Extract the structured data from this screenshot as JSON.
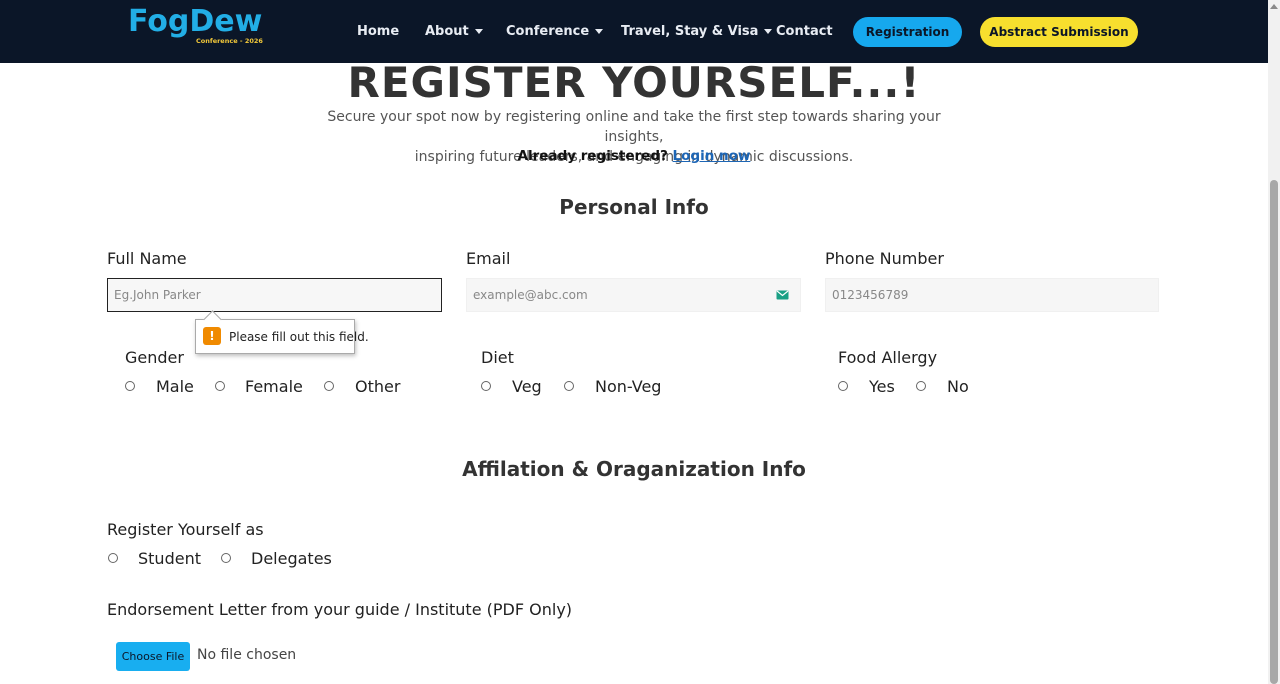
{
  "header": {
    "logo_text": "FogDew",
    "logo_sub": "Conference - 2026",
    "nav": [
      {
        "label": "Home"
      },
      {
        "label": "About"
      },
      {
        "label": "Conference"
      },
      {
        "label": "Travel, Stay & Visa"
      },
      {
        "label": "Contact"
      }
    ],
    "registration_label": "Registration",
    "abstract_label": "Abstract Submission"
  },
  "hero": {
    "title": "REGISTER YOURSELF...!",
    "subtitle_line1": "Secure your spot now by registering online and take the first step towards sharing your insights,",
    "subtitle_line2": "inspiring future leaders, and engaging in dynamic discussions.",
    "already_text": "Already registered?",
    "login_label": "Login now"
  },
  "personal": {
    "title": "Personal Info",
    "full_name_label": "Full Name",
    "full_name_placeholder": "Eg.John Parker",
    "email_label": "Email",
    "email_placeholder": "example@abc.com",
    "phone_label": "Phone Number",
    "phone_placeholder": "0123456789",
    "validation_message": "Please fill out this field.",
    "gender_label": "Gender",
    "gender_options": [
      "Male",
      "Female",
      "Other"
    ],
    "diet_label": "Diet",
    "diet_options": [
      "Veg",
      "Non-Veg"
    ],
    "allergy_label": "Food Allergy",
    "allergy_options": [
      "Yes",
      "No"
    ]
  },
  "affiliation": {
    "title": "Affilation & Oraganization Info",
    "register_as_label": "Register Yourself as",
    "register_as_options": [
      "Student",
      "Delegates"
    ],
    "endorsement_label": "Endorsement Letter from your guide / Institute (PDF Only)",
    "choose_file_label": "Choose File",
    "no_file_text": "No file chosen"
  },
  "colors": {
    "header_bg": "#0b1628",
    "accent_blue": "#16a8ee",
    "accent_yellow": "#f7df2e",
    "link": "#1d66b6",
    "warning": "#f08a00"
  }
}
